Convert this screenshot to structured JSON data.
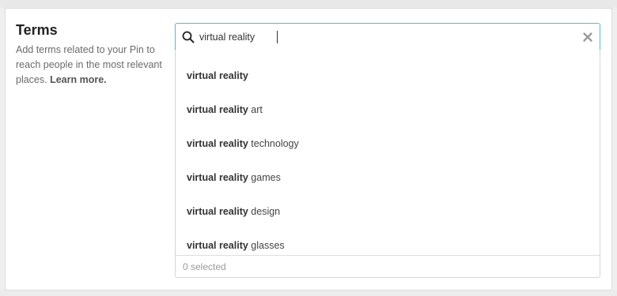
{
  "section": {
    "title": "Terms",
    "description": "Add terms related to your Pin to reach people in the most relevant places.",
    "learn_more": "Learn more."
  },
  "search": {
    "value": "virtual reality",
    "search_icon": "search-icon",
    "clear_icon": "close-icon"
  },
  "suggestions": [
    {
      "match": "virtual reality",
      "rest": ""
    },
    {
      "match": "virtual reality",
      "rest": " art"
    },
    {
      "match": "virtual reality",
      "rest": " technology"
    },
    {
      "match": "virtual reality",
      "rest": " games"
    },
    {
      "match": "virtual reality",
      "rest": " design"
    },
    {
      "match": "virtual reality",
      "rest": " glasses"
    }
  ],
  "footer": {
    "selected_text": "0 selected"
  },
  "colors": {
    "focus_border": "#4fb9d6",
    "text": "#333333",
    "muted": "#9a9a9a"
  }
}
